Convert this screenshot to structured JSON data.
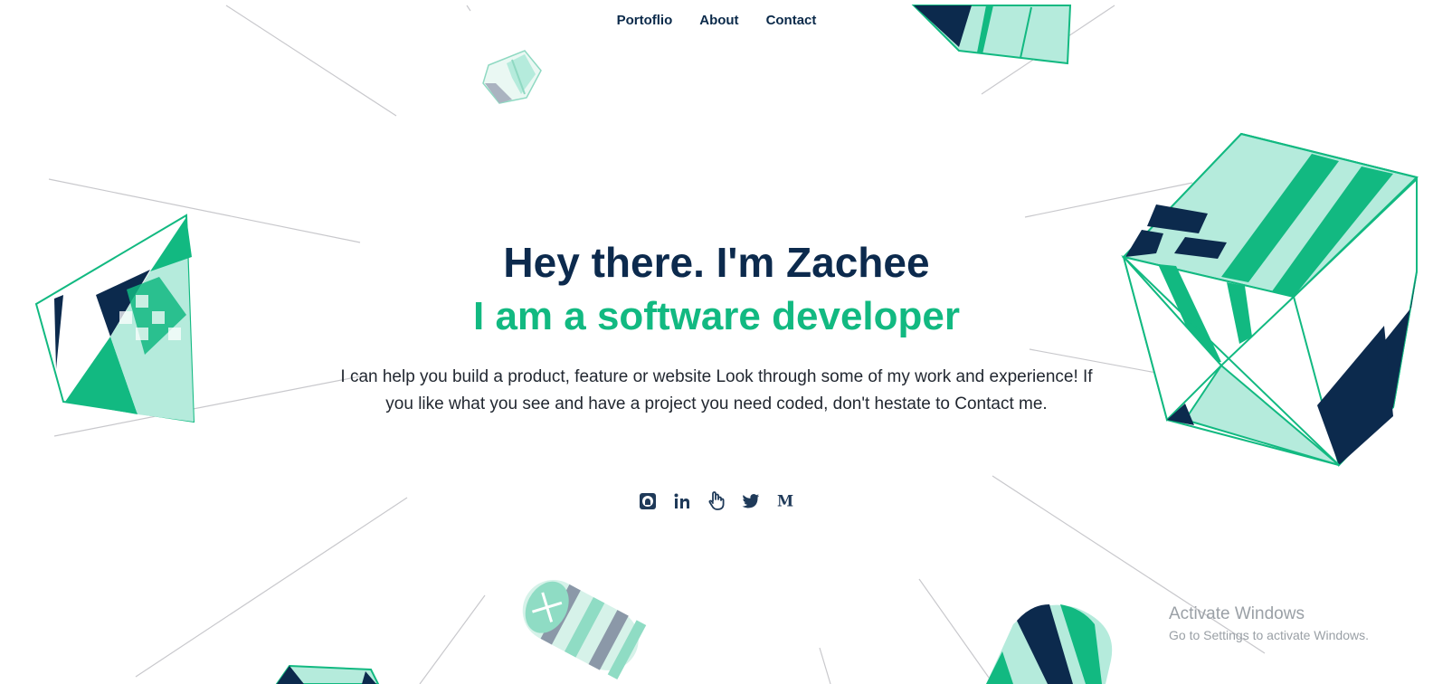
{
  "nav": {
    "items": [
      {
        "label": "Portoflio"
      },
      {
        "label": "About"
      },
      {
        "label": "Contact"
      }
    ]
  },
  "hero": {
    "heading": "Hey there. I'm Zachee",
    "subheading": "I am a software developer",
    "description": "I can help you build a product, feature or website Look through some of my work and experience! If you like what you see and have a project you need coded, don't hestate to Contact me."
  },
  "social": [
    {
      "icon": "github-icon",
      "glyph": "⌂"
    },
    {
      "icon": "linkedin-icon",
      "glyph": "in"
    },
    {
      "icon": "hand-icon",
      "glyph": "☝"
    },
    {
      "icon": "twitter-icon",
      "glyph": "🐦"
    },
    {
      "icon": "medium-icon",
      "glyph": "M"
    }
  ],
  "watermark": {
    "line1": "Activate Windows",
    "line2": "Go to Settings to activate Windows."
  },
  "colors": {
    "navy": "#0c2a4d",
    "green": "#12b981",
    "mint": "#b5ebdc",
    "line": "#c8c8cc"
  }
}
